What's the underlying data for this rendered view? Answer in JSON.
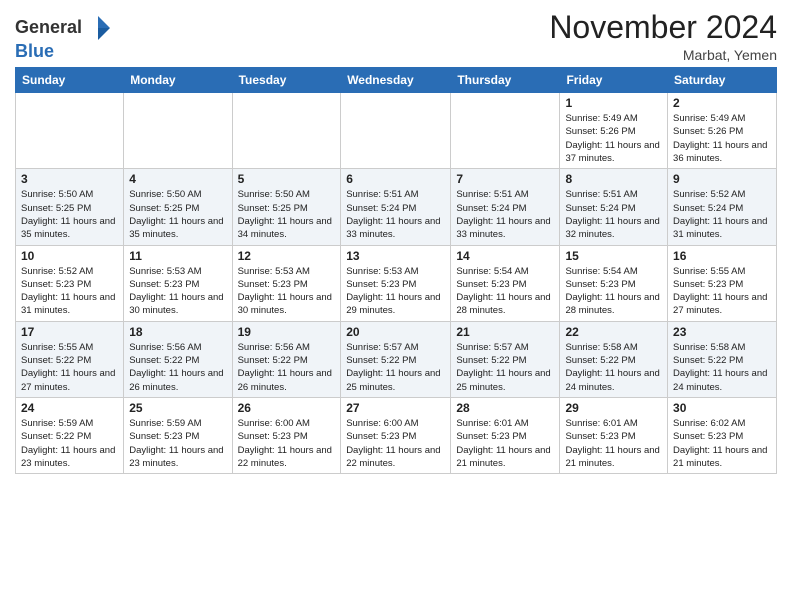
{
  "header": {
    "logo_line1": "General",
    "logo_line2": "Blue",
    "month": "November 2024",
    "location": "Marbat, Yemen"
  },
  "weekdays": [
    "Sunday",
    "Monday",
    "Tuesday",
    "Wednesday",
    "Thursday",
    "Friday",
    "Saturday"
  ],
  "weeks": [
    [
      {
        "day": "",
        "sunrise": "",
        "sunset": "",
        "daylight": ""
      },
      {
        "day": "",
        "sunrise": "",
        "sunset": "",
        "daylight": ""
      },
      {
        "day": "",
        "sunrise": "",
        "sunset": "",
        "daylight": ""
      },
      {
        "day": "",
        "sunrise": "",
        "sunset": "",
        "daylight": ""
      },
      {
        "day": "",
        "sunrise": "",
        "sunset": "",
        "daylight": ""
      },
      {
        "day": "1",
        "sunrise": "Sunrise: 5:49 AM",
        "sunset": "Sunset: 5:26 PM",
        "daylight": "Daylight: 11 hours and 37 minutes."
      },
      {
        "day": "2",
        "sunrise": "Sunrise: 5:49 AM",
        "sunset": "Sunset: 5:26 PM",
        "daylight": "Daylight: 11 hours and 36 minutes."
      }
    ],
    [
      {
        "day": "3",
        "sunrise": "Sunrise: 5:50 AM",
        "sunset": "Sunset: 5:25 PM",
        "daylight": "Daylight: 11 hours and 35 minutes."
      },
      {
        "day": "4",
        "sunrise": "Sunrise: 5:50 AM",
        "sunset": "Sunset: 5:25 PM",
        "daylight": "Daylight: 11 hours and 35 minutes."
      },
      {
        "day": "5",
        "sunrise": "Sunrise: 5:50 AM",
        "sunset": "Sunset: 5:25 PM",
        "daylight": "Daylight: 11 hours and 34 minutes."
      },
      {
        "day": "6",
        "sunrise": "Sunrise: 5:51 AM",
        "sunset": "Sunset: 5:24 PM",
        "daylight": "Daylight: 11 hours and 33 minutes."
      },
      {
        "day": "7",
        "sunrise": "Sunrise: 5:51 AM",
        "sunset": "Sunset: 5:24 PM",
        "daylight": "Daylight: 11 hours and 33 minutes."
      },
      {
        "day": "8",
        "sunrise": "Sunrise: 5:51 AM",
        "sunset": "Sunset: 5:24 PM",
        "daylight": "Daylight: 11 hours and 32 minutes."
      },
      {
        "day": "9",
        "sunrise": "Sunrise: 5:52 AM",
        "sunset": "Sunset: 5:24 PM",
        "daylight": "Daylight: 11 hours and 31 minutes."
      }
    ],
    [
      {
        "day": "10",
        "sunrise": "Sunrise: 5:52 AM",
        "sunset": "Sunset: 5:23 PM",
        "daylight": "Daylight: 11 hours and 31 minutes."
      },
      {
        "day": "11",
        "sunrise": "Sunrise: 5:53 AM",
        "sunset": "Sunset: 5:23 PM",
        "daylight": "Daylight: 11 hours and 30 minutes."
      },
      {
        "day": "12",
        "sunrise": "Sunrise: 5:53 AM",
        "sunset": "Sunset: 5:23 PM",
        "daylight": "Daylight: 11 hours and 30 minutes."
      },
      {
        "day": "13",
        "sunrise": "Sunrise: 5:53 AM",
        "sunset": "Sunset: 5:23 PM",
        "daylight": "Daylight: 11 hours and 29 minutes."
      },
      {
        "day": "14",
        "sunrise": "Sunrise: 5:54 AM",
        "sunset": "Sunset: 5:23 PM",
        "daylight": "Daylight: 11 hours and 28 minutes."
      },
      {
        "day": "15",
        "sunrise": "Sunrise: 5:54 AM",
        "sunset": "Sunset: 5:23 PM",
        "daylight": "Daylight: 11 hours and 28 minutes."
      },
      {
        "day": "16",
        "sunrise": "Sunrise: 5:55 AM",
        "sunset": "Sunset: 5:23 PM",
        "daylight": "Daylight: 11 hours and 27 minutes."
      }
    ],
    [
      {
        "day": "17",
        "sunrise": "Sunrise: 5:55 AM",
        "sunset": "Sunset: 5:22 PM",
        "daylight": "Daylight: 11 hours and 27 minutes."
      },
      {
        "day": "18",
        "sunrise": "Sunrise: 5:56 AM",
        "sunset": "Sunset: 5:22 PM",
        "daylight": "Daylight: 11 hours and 26 minutes."
      },
      {
        "day": "19",
        "sunrise": "Sunrise: 5:56 AM",
        "sunset": "Sunset: 5:22 PM",
        "daylight": "Daylight: 11 hours and 26 minutes."
      },
      {
        "day": "20",
        "sunrise": "Sunrise: 5:57 AM",
        "sunset": "Sunset: 5:22 PM",
        "daylight": "Daylight: 11 hours and 25 minutes."
      },
      {
        "day": "21",
        "sunrise": "Sunrise: 5:57 AM",
        "sunset": "Sunset: 5:22 PM",
        "daylight": "Daylight: 11 hours and 25 minutes."
      },
      {
        "day": "22",
        "sunrise": "Sunrise: 5:58 AM",
        "sunset": "Sunset: 5:22 PM",
        "daylight": "Daylight: 11 hours and 24 minutes."
      },
      {
        "day": "23",
        "sunrise": "Sunrise: 5:58 AM",
        "sunset": "Sunset: 5:22 PM",
        "daylight": "Daylight: 11 hours and 24 minutes."
      }
    ],
    [
      {
        "day": "24",
        "sunrise": "Sunrise: 5:59 AM",
        "sunset": "Sunset: 5:22 PM",
        "daylight": "Daylight: 11 hours and 23 minutes."
      },
      {
        "day": "25",
        "sunrise": "Sunrise: 5:59 AM",
        "sunset": "Sunset: 5:23 PM",
        "daylight": "Daylight: 11 hours and 23 minutes."
      },
      {
        "day": "26",
        "sunrise": "Sunrise: 6:00 AM",
        "sunset": "Sunset: 5:23 PM",
        "daylight": "Daylight: 11 hours and 22 minutes."
      },
      {
        "day": "27",
        "sunrise": "Sunrise: 6:00 AM",
        "sunset": "Sunset: 5:23 PM",
        "daylight": "Daylight: 11 hours and 22 minutes."
      },
      {
        "day": "28",
        "sunrise": "Sunrise: 6:01 AM",
        "sunset": "Sunset: 5:23 PM",
        "daylight": "Daylight: 11 hours and 21 minutes."
      },
      {
        "day": "29",
        "sunrise": "Sunrise: 6:01 AM",
        "sunset": "Sunset: 5:23 PM",
        "daylight": "Daylight: 11 hours and 21 minutes."
      },
      {
        "day": "30",
        "sunrise": "Sunrise: 6:02 AM",
        "sunset": "Sunset: 5:23 PM",
        "daylight": "Daylight: 11 hours and 21 minutes."
      }
    ]
  ]
}
